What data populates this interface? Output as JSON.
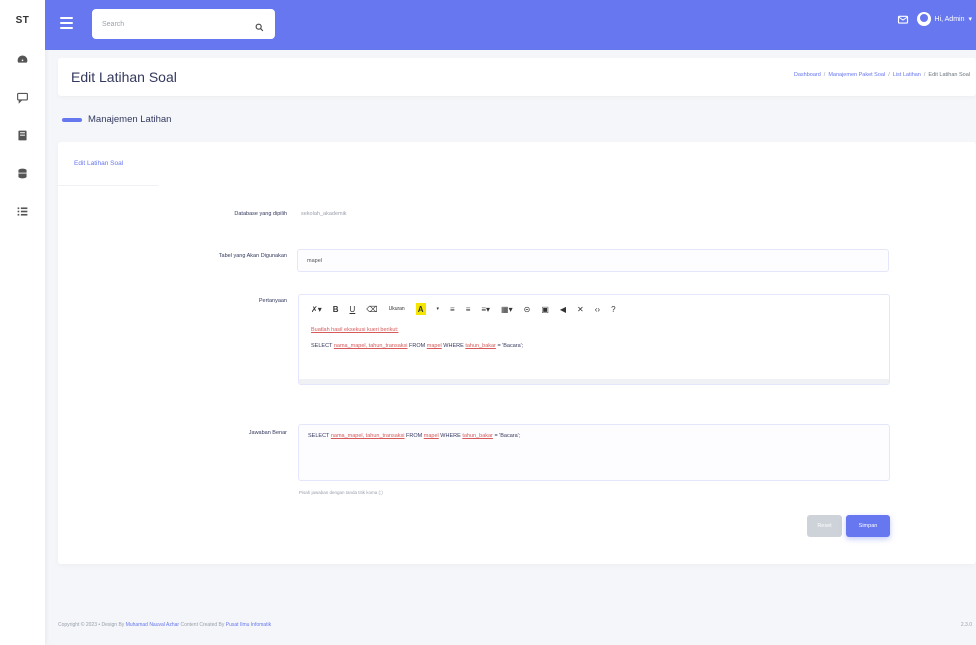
{
  "sidebar": {
    "brand": "ST",
    "icons": [
      "dashboard-icon",
      "chat-icon",
      "book-icon",
      "database-icon",
      "list-icon"
    ]
  },
  "navbar": {
    "search_placeholder": "Search",
    "user_name": "Hi, Admin"
  },
  "header": {
    "title": "Edit Latihan Soal",
    "breadcrumb": [
      "Dashboard",
      "Manajemen Paket Soal",
      "List Latihan",
      "Edit Latihan Soal"
    ]
  },
  "section": {
    "title": "Manajemen Latihan"
  },
  "card": {
    "title": "Edit Latihan Soal"
  },
  "form": {
    "database_label": "Database yang dipilih",
    "database_value": "sekolah_akademik",
    "table_label": "Tabel yang Akan Digunakan",
    "table_value": "mapel",
    "question_label": "Pertanyaan",
    "toolbar": {
      "font_size": "Ukuran",
      "items": [
        "magic-icon",
        "bold-icon",
        "underline-icon",
        "eraser-icon",
        "text-color-icon",
        "list-ul-icon",
        "list-ol-icon",
        "align-icon",
        "table-icon",
        "link-icon",
        "picture-icon",
        "video-icon",
        "fullscreen-icon",
        "code-icon",
        "help-icon"
      ]
    },
    "question_line1": "Buatlah hasil eksekusi kueri berikut:",
    "question_line2_prefix": "SELECT",
    "question_line2_underlined1": "nama_mapel, tahun_transaksi",
    "question_line2_middle": "FROM",
    "question_line2_underlined2": "mapel",
    "question_line2_where": "WHERE",
    "question_line2_underlined3": "tahun_bakar",
    "question_line2_suffix": "= 'Bacara';",
    "answer_label": "Jawaban Benar",
    "answer_prefix": "SELECT",
    "answer_underlined1": "nama_mapel, tahun_transaksi",
    "answer_middle": "FROM",
    "answer_underlined2": "mapel",
    "answer_where": "WHERE",
    "answer_underlined3": "tahun_bakar",
    "answer_suffix": "= 'Bacara';",
    "answer_hint": "Pisah jawaban dengan tanda titik koma (;)",
    "reset_label": "Reset",
    "save_label": "Simpan"
  },
  "footer": {
    "text_prefix": "Copyright © 2023 • Design By",
    "author": "Muhamad Nauval Azhar",
    "text_middle": "Content Created By",
    "creator": "Pusat Ilmu Infomatik",
    "version": "2.3.0"
  },
  "colors": {
    "primary": "#6777ef",
    "background": "#f4f6f9",
    "link_red": "#d65a5a"
  }
}
